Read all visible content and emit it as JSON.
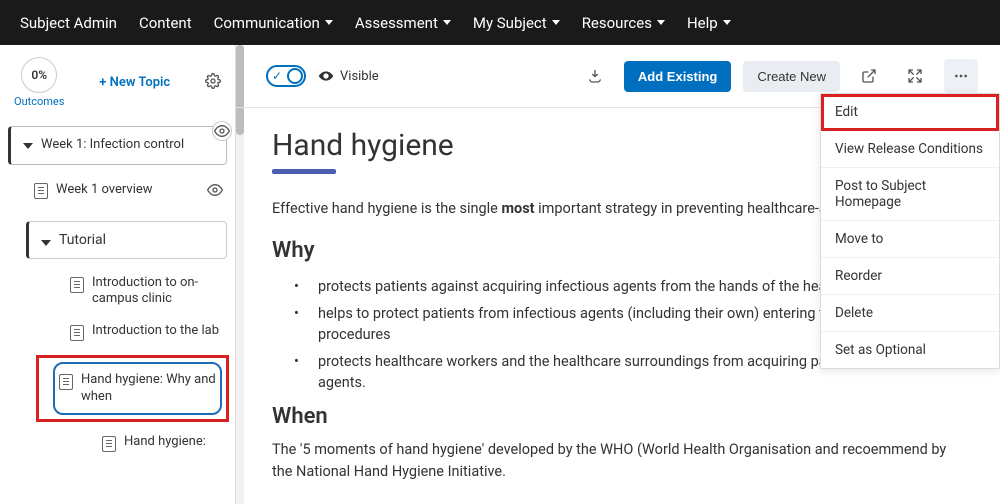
{
  "nav": {
    "items": [
      {
        "label": "Subject Admin",
        "has_menu": false
      },
      {
        "label": "Content",
        "has_menu": false
      },
      {
        "label": "Communication",
        "has_menu": true
      },
      {
        "label": "Assessment",
        "has_menu": true
      },
      {
        "label": "My Subject",
        "has_menu": true
      },
      {
        "label": "Resources",
        "has_menu": true
      },
      {
        "label": "Help",
        "has_menu": true
      }
    ]
  },
  "sidebar": {
    "outcomes_pct": "0%",
    "outcomes_label": "Outcomes",
    "new_topic": "+ New Topic",
    "module": {
      "title": "Week 1: Infection control"
    },
    "overview": {
      "label": "Week 1 overview"
    },
    "tutorial": {
      "label": "Tutorial"
    },
    "items": [
      {
        "label": "Introduction to on-campus clinic"
      },
      {
        "label": "Introduction to the lab"
      },
      {
        "label": "Hand hygiene: Why and when",
        "selected": true
      },
      {
        "label": "Hand hygiene:"
      }
    ]
  },
  "toolbar": {
    "visible_label": "Visible",
    "add_existing": "Add Existing",
    "create_new": "Create New"
  },
  "dropdown": {
    "items": [
      {
        "label": "Edit",
        "highlight": true
      },
      {
        "label": "View Release Conditions"
      },
      {
        "label": "Post to Subject Homepage"
      },
      {
        "label": "Move to"
      },
      {
        "label": "Reorder"
      },
      {
        "label": "Delete"
      },
      {
        "label": "Set as Optional"
      }
    ]
  },
  "page": {
    "title": "Hand hygiene",
    "intro_pre": "Effective hand hygiene is the single ",
    "intro_bold": "most",
    "intro_post": " important strategy in preventing healthcare-associated infections.",
    "why_heading": "Why",
    "why_bullets": [
      "protects patients against acquiring infectious agents from the hands of the healthcare worker",
      "helps to protect patients from infectious agents (including their own) entering their bodies during procedures",
      "protects healthcare workers and the healthcare surroundings from acquiring patients' infectious agents."
    ],
    "when_heading": "When",
    "when_para": "The '5 moments of hand hygiene' developed by the WHO (World Health Organisation and recoemmend by the National Hand Hygiene Initiative."
  }
}
